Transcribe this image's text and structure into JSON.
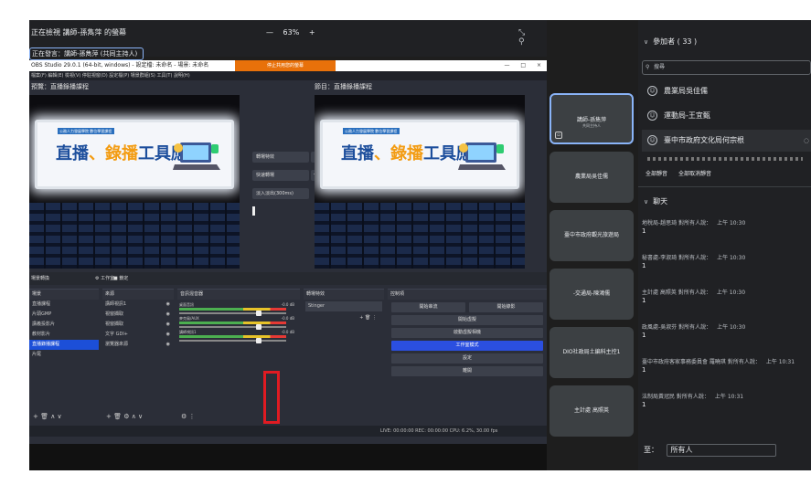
{
  "meet": {
    "share_title": "正在檢視 講師-孫雋萍 的螢幕",
    "presenter_label": "正在發言：講師-孫雋萍 (共同主持人)",
    "zoom": {
      "minus": "—",
      "value": "63%",
      "plus": "+"
    },
    "top_icons": [
      "⤡",
      "⚲"
    ]
  },
  "obs": {
    "window_title": "OBS Studio 29.0.1 (64-bit, windows) - 設定檔: 未命名 - 場景: 未命名",
    "stop_share": "停止共用您的螢幕",
    "win_buttons": [
      "—",
      "□",
      "×"
    ],
    "menu": "檔案(F)  編輯(E)  檢視(V)  停駐視窗(D)  設定檔(P)  場景群組(S)  工具(T)  說明(H)",
    "preview_label": "預覽：直播錄播課程",
    "program_label": "節目：直播錄播課程",
    "banner": {
      "tag": "公務人力發展學院 數位學習課程",
      "title_a": "直播",
      "title_mid": "、錄播",
      "title_b": "工具應用"
    },
    "transition": {
      "button": "轉場特效",
      "quick": "快速轉場",
      "fade": "淡入淡出(300ms)"
    },
    "docks_bar": {
      "label": "場景轉換",
      "studio": "⚙ 工作室",
      "lock": "■ 鎖定"
    },
    "scenes": {
      "title": "場景",
      "items": [
        "直播課程",
        "片頭GMP",
        "講義投影片",
        "教材影片",
        "直播錄播課程",
        "片尾"
      ],
      "selected_index": 4,
      "footer": "+ 🗑 ∧ ∨"
    },
    "sources": {
      "title": "來源",
      "items": [
        "講師視訊1",
        "視窗擷取",
        "視窗擷取",
        "文字 GDI+",
        "瀏覽器來源"
      ],
      "footer": "+ 🗑 ⚙ ∧ ∨"
    },
    "mixer": {
      "title": "音訊混音器",
      "channels": [
        {
          "name": "桌面音訊",
          "db": "-0.0 dB"
        },
        {
          "name": "麥克風/AUX",
          "db": "-0.0 dB"
        },
        {
          "name": "講師視訊1",
          "db": "-0.0 dB"
        }
      ],
      "footer": "⚙ ⋮"
    },
    "transitions_dock": {
      "title": "轉場特效",
      "value": "Stinger",
      "footer": "+ 🗑 ⋮"
    },
    "controls": {
      "title": "控制項",
      "start_stream": "開始串流",
      "start_record": "開始錄影",
      "virtual_cam": "開始虛擬",
      "studio_mode": "工作室模式",
      "settings": "設定",
      "exit": "離開",
      "replay": "啟動虛擬相機"
    },
    "status": "LIVE: 00:00:00   REC: 00:00:00   CPU: 6.2%, 30.00 fps"
  },
  "tiles": [
    {
      "name": "講師-孫雋萍",
      "sub": "共同主持人",
      "active": true
    },
    {
      "name": "農業局吳佳儒",
      "sub": "",
      "active": false
    },
    {
      "name": "臺中市政府觀光旅遊局",
      "sub": "",
      "active": false
    },
    {
      "name": "-交通局-陳鴻儒",
      "sub": "",
      "active": false
    },
    {
      "name": "DIO社政局土編科主控1",
      "sub": "",
      "active": false
    },
    {
      "name": "主計處 高照英",
      "sub": "",
      "active": false
    }
  ],
  "participants": {
    "header": "參加者 ( 33 )",
    "search_placeholder": "搜尋",
    "list": [
      "農業局吳佳儒",
      "運動局-王宜甄",
      "臺中市政府文化局何宗根"
    ],
    "mute_all": "全部靜音",
    "unmute_all": "全部取消靜音"
  },
  "chat": {
    "header": "聊天",
    "messages": [
      {
        "from": "地稅局-趙思琦 對所有人說：",
        "time": "上午 10:30",
        "body": "1"
      },
      {
        "from": "秘書處-李淑琦 對所有人說：",
        "time": "上午 10:30",
        "body": "1"
      },
      {
        "from": "主計處 高照英 對所有人說：",
        "time": "上午 10:30",
        "body": "1"
      },
      {
        "from": "政風處-吳淑芬 對所有人說：",
        "time": "上午 10:30",
        "body": "1"
      },
      {
        "from": "臺中市政府客家事務委員會 羅曉琪 對所有人說：",
        "time": "上午 10:31",
        "body": "1"
      },
      {
        "from": "法制局黃冠民 對所有人說：",
        "time": "上午 10:31",
        "body": "1"
      }
    ],
    "to_label": "至：",
    "to_value": "所有人"
  }
}
